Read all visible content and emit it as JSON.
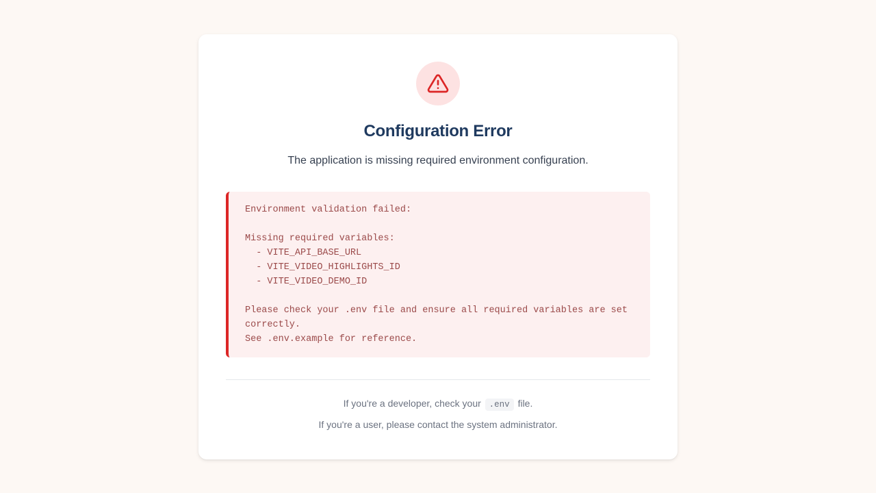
{
  "icon": {
    "name": "warning-triangle-icon",
    "color": "#dc2626",
    "background": "#fde2e2"
  },
  "title": "Configuration Error",
  "subtitle": "The application is missing required environment configuration.",
  "error_details": "Environment validation failed:\n\nMissing required variables:\n  - VITE_API_BASE_URL\n  - VITE_VIDEO_HIGHLIGHTS_ID\n  - VITE_VIDEO_DEMO_ID\n\nPlease check your .env file and ensure all required variables are set correctly.\nSee .env.example for reference.",
  "footer": {
    "developer_prefix": "If you're a developer, check your",
    "developer_code": ".env",
    "developer_suffix": "file.",
    "user_text": "If you're a user, please contact the system administrator."
  },
  "colors": {
    "page_background": "#fdf8f4",
    "accent": "#dc2626",
    "title": "#1f3a5f"
  }
}
